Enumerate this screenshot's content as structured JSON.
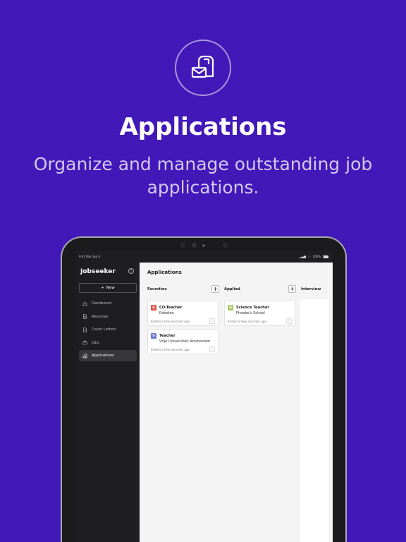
{
  "hero": {
    "title": "Applications",
    "subtitle": "Organize and manage outstanding job applications.",
    "icon": "mailbox-icon"
  },
  "status_bar": {
    "time": "9:41",
    "date": "Mon Jun 6",
    "battery": "100%"
  },
  "sidebar": {
    "brand": "Jobseeker",
    "help_icon": "?",
    "new_button": "New",
    "items": [
      {
        "label": "Dashboard",
        "icon": "home-icon",
        "active": false
      },
      {
        "label": "Resumes",
        "icon": "document-icon",
        "active": false
      },
      {
        "label": "Cover Letters",
        "icon": "letter-icon",
        "active": false
      },
      {
        "label": "Jobs",
        "icon": "briefcase-icon",
        "active": false
      },
      {
        "label": "Applications",
        "icon": "mailbox-icon",
        "active": true
      }
    ]
  },
  "main": {
    "title": "Applications",
    "columns": [
      {
        "name": "Favorites",
        "cards": [
          {
            "badge": "R",
            "badge_color": "#e0584a",
            "title": "CO-Teacher",
            "company": "Robotoo",
            "edited": "Edited a few seconds ago"
          },
          {
            "badge": "V",
            "badge_color": "#6a7fcf",
            "title": "Teacher",
            "company": "Vrije Universiteit Amsterdam",
            "edited": "Edited a few seconds ago"
          }
        ]
      },
      {
        "name": "Applied",
        "cards": [
          {
            "badge": "H",
            "badge_color": "#a8c96a",
            "title": "Science Teacher",
            "company": "Phoebe's School",
            "edited": "Edited a few seconds ago"
          }
        ]
      },
      {
        "name": "Interview",
        "cards": []
      }
    ]
  },
  "colors": {
    "background": "#4218b8",
    "sidebar": "#1e1e20",
    "main": "#f4f4f5"
  }
}
